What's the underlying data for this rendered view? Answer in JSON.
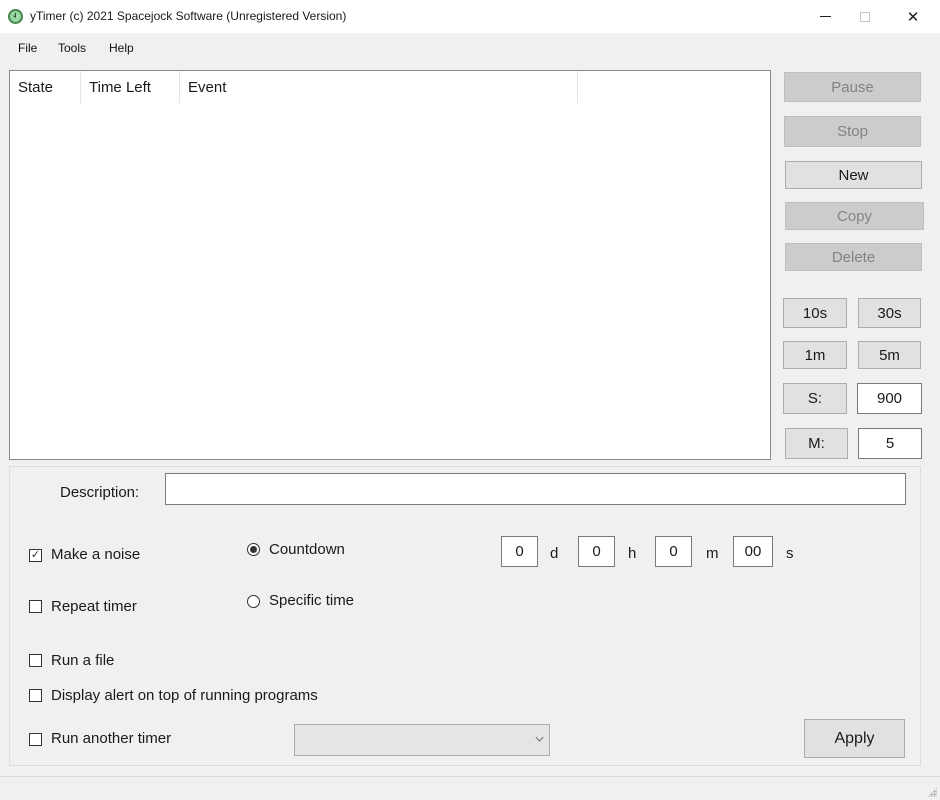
{
  "window": {
    "title": "yTimer (c) 2021 Spacejock Software (Unregistered Version)",
    "icon": "clock-icon",
    "controls": {
      "minimize": "minimize-icon",
      "maximize": "maximize-icon",
      "close": "close-icon"
    }
  },
  "menu": {
    "items": [
      "File",
      "Tools",
      "Help"
    ]
  },
  "list": {
    "columns": [
      "State",
      "Time Left",
      "Event",
      ""
    ],
    "rows": []
  },
  "side": {
    "pause": {
      "label": "Pause",
      "enabled": false
    },
    "stop": {
      "label": "Stop",
      "enabled": false
    },
    "new": {
      "label": "New",
      "enabled": true
    },
    "copy": {
      "label": "Copy",
      "enabled": false
    },
    "delete": {
      "label": "Delete",
      "enabled": false
    },
    "quick": [
      "10s",
      "30s",
      "1m",
      "5m"
    ],
    "s_label": "S:",
    "s_value": "900",
    "m_label": "M:",
    "m_value": "5"
  },
  "form": {
    "description_label": "Description:",
    "description_value": "",
    "make_noise": {
      "label": "Make a noise",
      "checked": true,
      "glyph": "✓"
    },
    "repeat_timer": {
      "label": "Repeat timer",
      "checked": false
    },
    "run_file": {
      "label": "Run a file",
      "checked": false
    },
    "display_alert": {
      "label": "Display alert on top of running programs",
      "checked": false
    },
    "run_another": {
      "label": "Run another timer",
      "checked": false
    },
    "countdown": {
      "label": "Countdown",
      "selected": true
    },
    "specific_time": {
      "label": "Specific time",
      "selected": false
    },
    "duration": {
      "days": "0",
      "days_unit": "d",
      "hours": "0",
      "hours_unit": "h",
      "minutes": "0",
      "minutes_unit": "m",
      "seconds": "00",
      "seconds_unit": "s"
    },
    "timer_select_value": "",
    "apply_label": "Apply"
  }
}
